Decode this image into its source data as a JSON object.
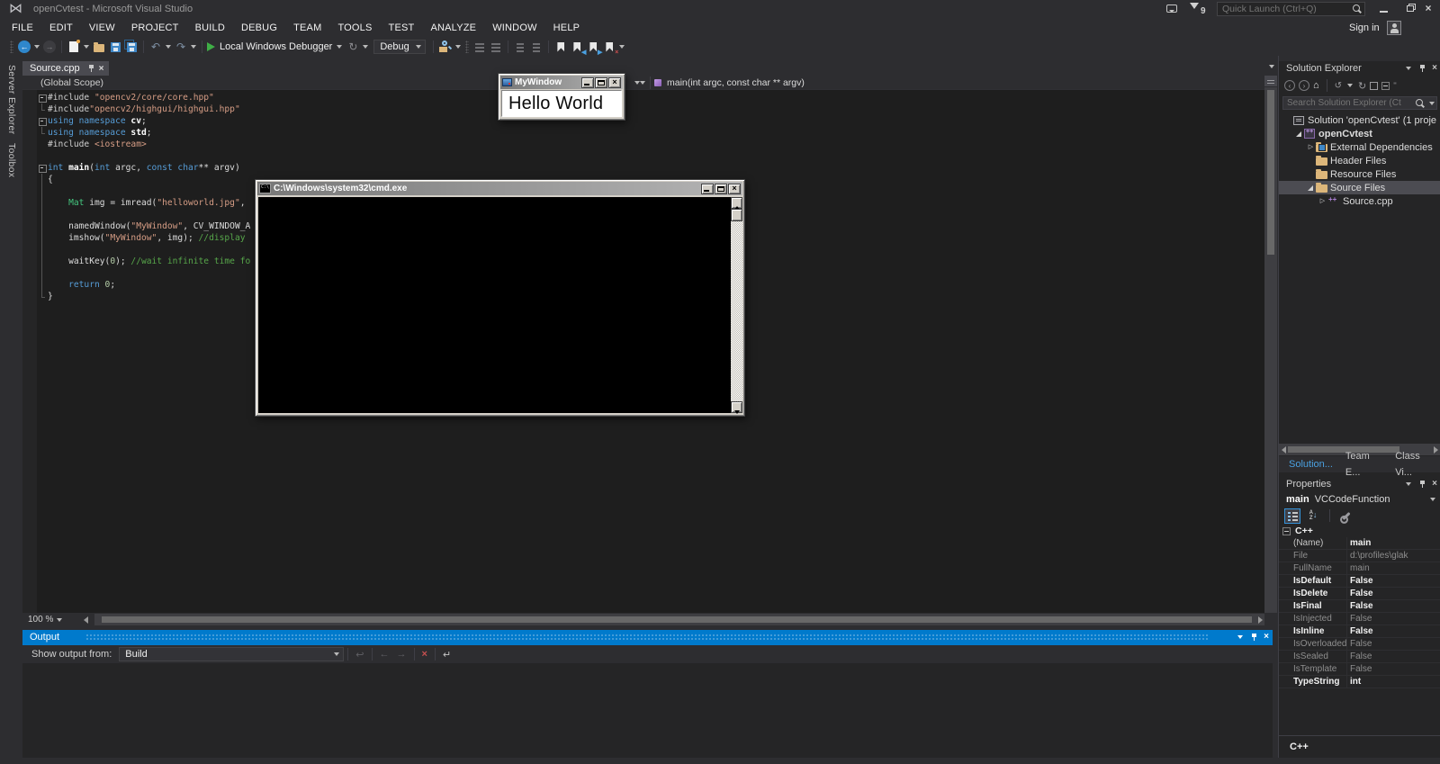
{
  "titlebar": {
    "title": "openCvtest - Microsoft Visual Studio",
    "notification_count": "9",
    "quick_launch_placeholder": "Quick Launch (Ctrl+Q)"
  },
  "menubar": {
    "items": [
      "FILE",
      "EDIT",
      "VIEW",
      "PROJECT",
      "BUILD",
      "DEBUG",
      "TEAM",
      "TOOLS",
      "TEST",
      "ANALYZE",
      "WINDOW",
      "HELP"
    ],
    "sign_in": "Sign in"
  },
  "toolbar": {
    "debug_target": "Local Windows Debugger",
    "configuration": "Debug"
  },
  "left_tabs": [
    "Server Explorer",
    "Toolbox"
  ],
  "editor": {
    "tab_title": "Source.cpp",
    "nav_left": "(Global Scope)",
    "nav_right": "main(int argc, const char ** argv)",
    "zoom_level": "100 %",
    "code_lines": [
      {
        "fold": "box",
        "segs": [
          {
            "c": "pp",
            "t": "#include "
          },
          {
            "c": "str",
            "t": "\"opencv2/core/core.hpp\""
          }
        ]
      },
      {
        "fold": "end",
        "segs": [
          {
            "c": "pp",
            "t": "#include"
          },
          {
            "c": "str",
            "t": "\"opencv2/highgui/highgui.hpp\""
          }
        ]
      },
      {
        "fold": "box",
        "segs": [
          {
            "c": "kw",
            "t": "using namespace "
          },
          {
            "c": "b",
            "t": "cv"
          },
          {
            "c": "pl",
            "t": ";"
          }
        ]
      },
      {
        "fold": "end",
        "segs": [
          {
            "c": "kw",
            "t": "using namespace "
          },
          {
            "c": "b",
            "t": "std"
          },
          {
            "c": "pl",
            "t": ";"
          }
        ]
      },
      {
        "fold": "",
        "segs": [
          {
            "c": "pp",
            "t": "#include "
          },
          {
            "c": "str",
            "t": "<iostream>"
          }
        ]
      },
      {
        "fold": "",
        "segs": []
      },
      {
        "fold": "box",
        "segs": [
          {
            "c": "kw",
            "t": "int "
          },
          {
            "c": "b",
            "t": "main"
          },
          {
            "c": "pl",
            "t": "("
          },
          {
            "c": "kw",
            "t": "int"
          },
          {
            "c": "pl",
            "t": " argc, "
          },
          {
            "c": "kw",
            "t": "const char"
          },
          {
            "c": "pl",
            "t": "** argv)"
          }
        ]
      },
      {
        "fold": "bar",
        "segs": [
          {
            "c": "pl",
            "t": "{"
          }
        ]
      },
      {
        "fold": "bar",
        "segs": []
      },
      {
        "fold": "bar",
        "segs": [
          {
            "c": "pl",
            "t": "    "
          },
          {
            "c": "type",
            "t": "Mat"
          },
          {
            "c": "pl",
            "t": " img = imread("
          },
          {
            "c": "str",
            "t": "\"helloworld.jpg\""
          },
          {
            "c": "pl",
            "t": ", "
          }
        ]
      },
      {
        "fold": "bar",
        "segs": []
      },
      {
        "fold": "bar",
        "segs": [
          {
            "c": "pl",
            "t": "    namedWindow("
          },
          {
            "c": "str",
            "t": "\"MyWindow\""
          },
          {
            "c": "pl",
            "t": ", CV_WINDOW_A"
          }
        ]
      },
      {
        "fold": "bar",
        "segs": [
          {
            "c": "pl",
            "t": "    imshow("
          },
          {
            "c": "str",
            "t": "\"MyWindow\""
          },
          {
            "c": "pl",
            "t": ", img); "
          },
          {
            "c": "cm",
            "t": "//display "
          }
        ]
      },
      {
        "fold": "bar",
        "segs": []
      },
      {
        "fold": "bar",
        "segs": [
          {
            "c": "pl",
            "t": "    waitKey("
          },
          {
            "c": "num",
            "t": "0"
          },
          {
            "c": "pl",
            "t": "); "
          },
          {
            "c": "cm",
            "t": "//wait infinite time fo"
          }
        ]
      },
      {
        "fold": "bar",
        "segs": []
      },
      {
        "fold": "bar",
        "segs": [
          {
            "c": "pl",
            "t": "    "
          },
          {
            "c": "kw",
            "t": "return "
          },
          {
            "c": "num",
            "t": "0"
          },
          {
            "c": "pl",
            "t": ";"
          }
        ]
      },
      {
        "fold": "end",
        "segs": [
          {
            "c": "pl",
            "t": "}"
          }
        ]
      }
    ]
  },
  "mywindow": {
    "title": "MyWindow",
    "text": "Hello World"
  },
  "cmd_window": {
    "title": "C:\\Windows\\system32\\cmd.exe"
  },
  "solution_explorer": {
    "title": "Solution Explorer",
    "search_placeholder": "Search Solution Explorer (Ct",
    "tree": [
      {
        "label": "Solution 'openCvtest' (1 proje",
        "icon": "solution",
        "depth": 0,
        "expander": "none",
        "bold": false,
        "selected": false
      },
      {
        "label": "openCvtest",
        "icon": "project",
        "depth": 1,
        "expander": "open",
        "bold": true,
        "selected": false
      },
      {
        "label": "External Dependencies",
        "icon": "folder-ref",
        "depth": 2,
        "expander": "closed",
        "bold": false,
        "selected": false
      },
      {
        "label": "Header Files",
        "icon": "folder",
        "depth": 2,
        "expander": "none",
        "bold": false,
        "selected": false
      },
      {
        "label": "Resource Files",
        "icon": "folder",
        "depth": 2,
        "expander": "none",
        "bold": false,
        "selected": false
      },
      {
        "label": "Source Files",
        "icon": "folder",
        "depth": 2,
        "expander": "open",
        "bold": false,
        "selected": true
      },
      {
        "label": "Source.cpp",
        "icon": "cpp",
        "depth": 3,
        "expander": "closed",
        "bold": false,
        "selected": false
      }
    ],
    "tabs": [
      {
        "label": "Solution...",
        "active": true
      },
      {
        "label": "Team E...",
        "active": false
      },
      {
        "label": "Class Vi...",
        "active": false
      }
    ]
  },
  "properties": {
    "title": "Properties",
    "object_name": "main",
    "object_type": "VCCodeFunction",
    "section_header": "C++",
    "rows": [
      {
        "label": "(Name)",
        "value": "main",
        "style": "value-bold"
      },
      {
        "label": "File",
        "value": "d:\\profiles\\glak",
        "style": "dim"
      },
      {
        "label": "FullName",
        "value": "main",
        "style": "dim"
      },
      {
        "label": "IsDefault",
        "value": "False",
        "style": "bold"
      },
      {
        "label": "IsDelete",
        "value": "False",
        "style": "bold"
      },
      {
        "label": "IsFinal",
        "value": "False",
        "style": "bold"
      },
      {
        "label": "IsInjected",
        "value": "False",
        "style": "dim"
      },
      {
        "label": "IsInline",
        "value": "False",
        "style": "bold"
      },
      {
        "label": "IsOverloaded",
        "value": "False",
        "style": "dim"
      },
      {
        "label": "IsSealed",
        "value": "False",
        "style": "dim"
      },
      {
        "label": "IsTemplate",
        "value": "False",
        "style": "dim"
      },
      {
        "label": "TypeString",
        "value": "int",
        "style": "bold"
      }
    ],
    "description": "C++"
  },
  "output": {
    "title": "Output",
    "show_output_from": "Show output from:",
    "source": "Build"
  },
  "colors": {
    "accent": "#007acc",
    "keyword": "#569cd6",
    "string": "#d69d85",
    "comment": "#57a64a",
    "type": "#44c57e",
    "number": "#b5cea8",
    "editor_bg": "#1e1e1e",
    "chrome_bg": "#2d2d30",
    "panel_bg": "#252526"
  }
}
